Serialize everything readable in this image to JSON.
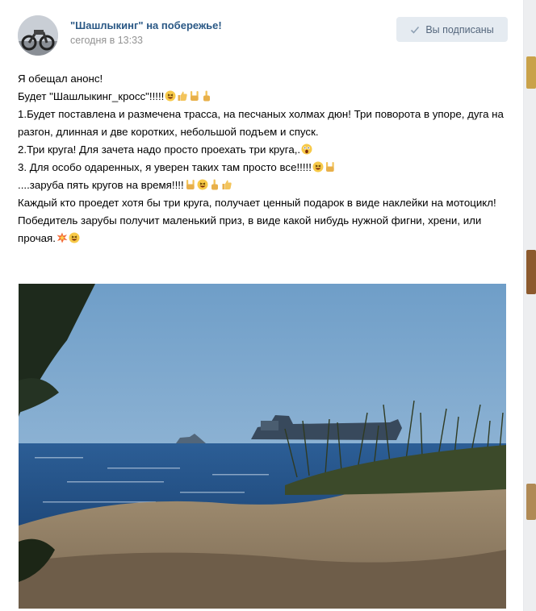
{
  "post": {
    "author": "\"Шашлыкинг\" на побережье!",
    "date": "сегодня в 13:33",
    "subscribe_label": "Вы подписаны",
    "lines": [
      {
        "text": "Я обещал анонс!",
        "emoji": []
      },
      {
        "text": "Будет \"Шашлыкинг_кросс\"!!!!!",
        "emoji": [
          "grin-emoji",
          "thumbs-up-emoji",
          "rock-hand-emoji",
          "pointing-up-emoji"
        ]
      },
      {
        "text": "1.Будет поставлена и размечена трасса, на песчаных холмах дюн! Три поворота в упоре, дуга на разгон, длинная и две коротких, небольшой подъем и спуск.",
        "emoji": []
      },
      {
        "text": "2.Три круга! Для зачета надо просто проехать три круга,.",
        "emoji": [
          "scream-emoji"
        ]
      },
      {
        "text": "3. Для особо одаренных, я уверен таких там просто все!!!!!",
        "emoji": [
          "grin-emoji",
          "rock-hand-emoji"
        ]
      },
      {
        "text": "....заруба пять кругов на время!!!!",
        "emoji": [
          "rock-hand-emoji",
          "grin-emoji",
          "pointing-up-emoji",
          "thumbs-up-emoji"
        ]
      },
      {
        "text": "Каждый кто проедет хотя бы три круга, получает ценный подарок в виде наклейки на мотоцикл!",
        "emoji": []
      },
      {
        "text": "Победитель зарубы получит маленький приз, в виде какой нибудь нужной фигни, хрени, или прочая.",
        "emoji": [
          "collision-emoji",
          "grin-emoji"
        ]
      }
    ]
  },
  "icons": {
    "subscribe": "check-icon"
  },
  "colors": {
    "author_link": "#2a5885",
    "meta_gray": "#939393",
    "button_bg": "#e5ebf1",
    "button_text": "#55677d"
  }
}
